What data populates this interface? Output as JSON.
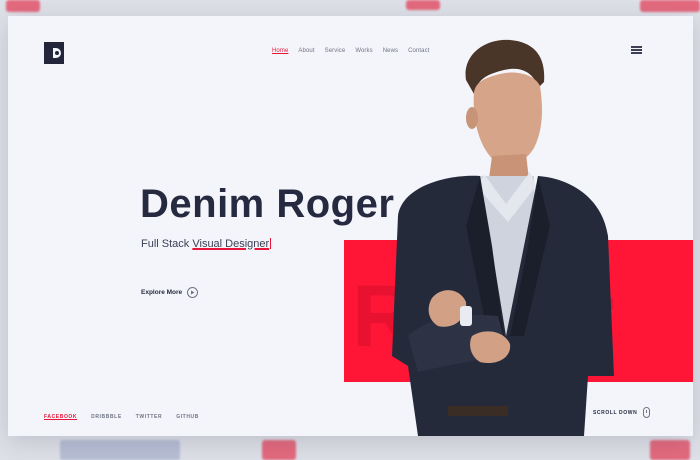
{
  "brand": {
    "logo": "D"
  },
  "nav": {
    "items": [
      {
        "label": "Home",
        "active": true
      },
      {
        "label": "About"
      },
      {
        "label": "Service"
      },
      {
        "label": "Works"
      },
      {
        "label": "News"
      },
      {
        "label": "Contact"
      }
    ]
  },
  "hero": {
    "name": "Denim Roger",
    "role_prefix": "Full Stack ",
    "role_highlight": "Visual Designer",
    "explore_label": "Explore More",
    "background_word": "Roger"
  },
  "socials": [
    {
      "label": "FACEBOOK",
      "active": true
    },
    {
      "label": "DRIBBBLE"
    },
    {
      "label": "TWITTER"
    },
    {
      "label": "GITHUB"
    }
  ],
  "scroll": {
    "label": "SCROLL DOWN"
  },
  "colors": {
    "accent": "#ff1637",
    "ink": "#262a40",
    "muted": "#6f7385",
    "surface": "#f4f5fa"
  }
}
